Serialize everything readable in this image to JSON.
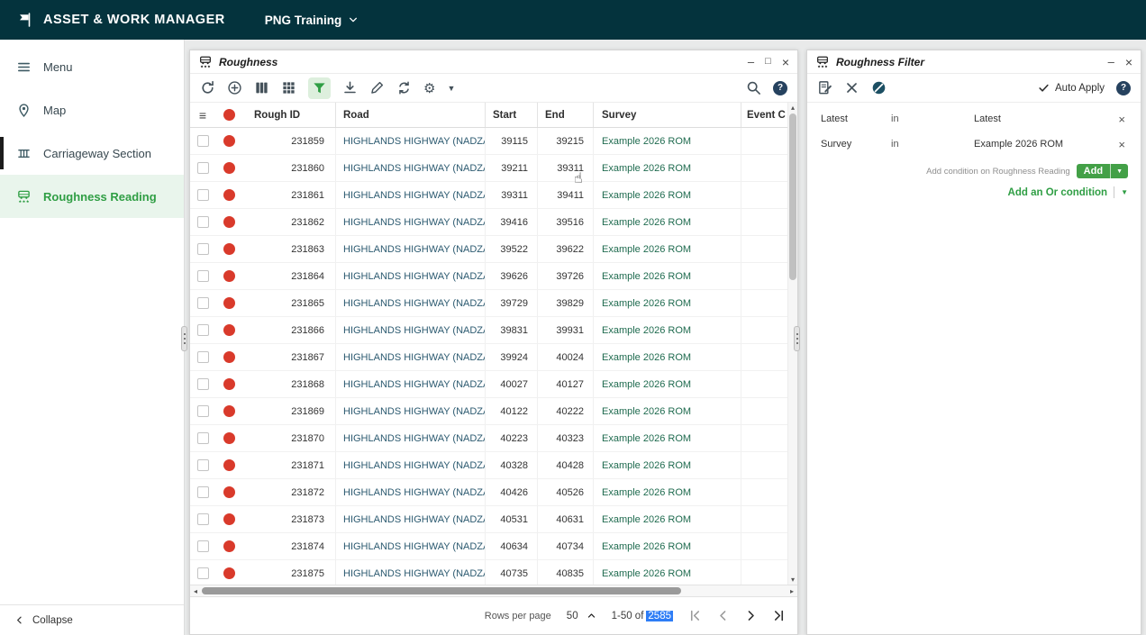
{
  "colors": {
    "topbar_bg": "#04333d",
    "accent_green": "#2f9e44",
    "active_item_bg": "#e9f5ec",
    "status_red": "#d93a2b",
    "selection_blue": "#2e7df6",
    "road_text": "#2c5a70",
    "survey_text": "#1f6b4f",
    "help_badge_navy": "#26425f"
  },
  "topbar": {
    "app_title": "ASSET & WORK MANAGER",
    "environment": "PNG Training"
  },
  "sidebar": {
    "items": [
      {
        "label": "Menu",
        "icon": "menu-icon"
      },
      {
        "label": "Map",
        "icon": "map-pin-icon"
      },
      {
        "label": "Carriageway Section",
        "icon": "carriageway-icon"
      },
      {
        "label": "Roughness Reading",
        "icon": "roughness-icon"
      }
    ],
    "collapse_label": "Collapse"
  },
  "roughness_window": {
    "title": "Roughness",
    "toolbar_icons": [
      "refresh-icon",
      "add-circle-icon",
      "columns-icon",
      "grid-icon",
      "filter-icon",
      "download-icon",
      "edit-icon",
      "sync-icon",
      "gear-icon",
      "caret-down-icon",
      "search-icon",
      "help-icon"
    ],
    "table": {
      "columns": [
        "Rough ID",
        "Road",
        "Start",
        "End",
        "Survey",
        "Event C"
      ],
      "rows": [
        {
          "rough_id": "231859",
          "road": "HIGHLANDS HIGHWAY (NADZAB ...",
          "start": "39115",
          "end": "39215",
          "survey": "Example 2026 ROM"
        },
        {
          "rough_id": "231860",
          "road": "HIGHLANDS HIGHWAY (NADZAB ...",
          "start": "39211",
          "end": "39311",
          "survey": "Example 2026 ROM"
        },
        {
          "rough_id": "231861",
          "road": "HIGHLANDS HIGHWAY (NADZAB ...",
          "start": "39311",
          "end": "39411",
          "survey": "Example 2026 ROM"
        },
        {
          "rough_id": "231862",
          "road": "HIGHLANDS HIGHWAY (NADZAB ...",
          "start": "39416",
          "end": "39516",
          "survey": "Example 2026 ROM"
        },
        {
          "rough_id": "231863",
          "road": "HIGHLANDS HIGHWAY (NADZAB ...",
          "start": "39522",
          "end": "39622",
          "survey": "Example 2026 ROM"
        },
        {
          "rough_id": "231864",
          "road": "HIGHLANDS HIGHWAY (NADZAB ...",
          "start": "39626",
          "end": "39726",
          "survey": "Example 2026 ROM"
        },
        {
          "rough_id": "231865",
          "road": "HIGHLANDS HIGHWAY (NADZAB ...",
          "start": "39729",
          "end": "39829",
          "survey": "Example 2026 ROM"
        },
        {
          "rough_id": "231866",
          "road": "HIGHLANDS HIGHWAY (NADZAB ...",
          "start": "39831",
          "end": "39931",
          "survey": "Example 2026 ROM"
        },
        {
          "rough_id": "231867",
          "road": "HIGHLANDS HIGHWAY (NADZAB ...",
          "start": "39924",
          "end": "40024",
          "survey": "Example 2026 ROM"
        },
        {
          "rough_id": "231868",
          "road": "HIGHLANDS HIGHWAY (NADZAB ...",
          "start": "40027",
          "end": "40127",
          "survey": "Example 2026 ROM"
        },
        {
          "rough_id": "231869",
          "road": "HIGHLANDS HIGHWAY (NADZAB ...",
          "start": "40122",
          "end": "40222",
          "survey": "Example 2026 ROM"
        },
        {
          "rough_id": "231870",
          "road": "HIGHLANDS HIGHWAY (NADZAB ...",
          "start": "40223",
          "end": "40323",
          "survey": "Example 2026 ROM"
        },
        {
          "rough_id": "231871",
          "road": "HIGHLANDS HIGHWAY (NADZAB ...",
          "start": "40328",
          "end": "40428",
          "survey": "Example 2026 ROM"
        },
        {
          "rough_id": "231872",
          "road": "HIGHLANDS HIGHWAY (NADZAB ...",
          "start": "40426",
          "end": "40526",
          "survey": "Example 2026 ROM"
        },
        {
          "rough_id": "231873",
          "road": "HIGHLANDS HIGHWAY (NADZAB ...",
          "start": "40531",
          "end": "40631",
          "survey": "Example 2026 ROM"
        },
        {
          "rough_id": "231874",
          "road": "HIGHLANDS HIGHWAY (NADZAB ...",
          "start": "40634",
          "end": "40734",
          "survey": "Example 2026 ROM"
        },
        {
          "rough_id": "231875",
          "road": "HIGHLANDS HIGHWAY (NADZAB ...",
          "start": "40735",
          "end": "40835",
          "survey": "Example 2026 ROM"
        }
      ]
    },
    "footer": {
      "rows_per_page_label": "Rows per page",
      "rows_per_page_value": "50",
      "range_text": "1-50 of",
      "total_count": "2585"
    }
  },
  "filter_window": {
    "title": "Roughness Filter",
    "toolbar_icons": [
      "edit-document-icon",
      "clear-filter-icon",
      "circle-slash-icon",
      "auto-apply-check-icon",
      "help-icon"
    ],
    "auto_apply_label": "Auto Apply",
    "conditions": [
      {
        "field": "Latest",
        "operator": "in",
        "value": "Latest"
      },
      {
        "field": "Survey",
        "operator": "in",
        "value": "Example 2026 ROM"
      }
    ],
    "add_condition_hint": "Add condition on Roughness Reading",
    "add_button_label": "Add",
    "add_or_label": "Add an Or condition"
  }
}
